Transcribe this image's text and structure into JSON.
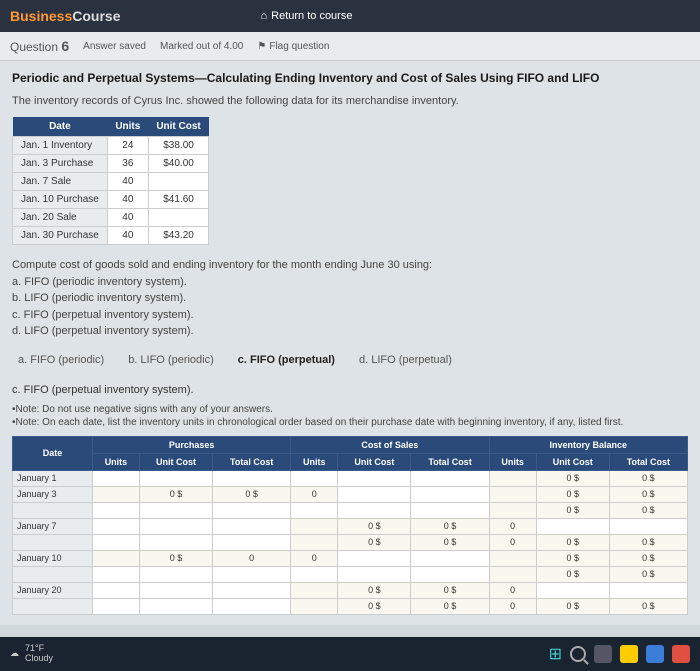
{
  "header": {
    "logo1": "Business",
    "logo2": "Course",
    "return": "Return to course"
  },
  "qbar": {
    "label": "Question",
    "num": "6",
    "saved": "Answer saved",
    "marked": "Marked out of 4.00",
    "flag": "Flag question"
  },
  "title": "Periodic and Perpetual Systems—Calculating Ending Inventory and Cost of Sales Using FIFO and LIFO",
  "intro": "The inventory records of Cyrus Inc. showed the following data for its merchandise inventory.",
  "inv": {
    "h1": "Date",
    "h2": "Units",
    "h3": "Unit Cost",
    "r1c1": "Jan. 1 Inventory",
    "r1c2": "24",
    "r1c3": "$38.00",
    "r2c1": "Jan. 3 Purchase",
    "r2c2": "36",
    "r2c3": "$40.00",
    "r3c1": "Jan. 7 Sale",
    "r3c2": "40",
    "r3c3": "",
    "r4c1": "Jan. 10 Purchase",
    "r4c2": "40",
    "r4c3": "$41.60",
    "r5c1": "Jan. 20 Sale",
    "r5c2": "40",
    "r5c3": "",
    "r6c1": "Jan. 30 Purchase",
    "r6c2": "40",
    "r6c3": "$43.20"
  },
  "compute": {
    "lead": "Compute cost of goods sold and ending inventory for the month ending June 30 using:",
    "a": "a. FIFO (periodic inventory system).",
    "b": "b. LIFO (periodic inventory system).",
    "c": "c. FIFO (perpetual inventory system).",
    "d": "d. LIFO (perpetual inventory system)."
  },
  "tabs": {
    "a": "a. FIFO (periodic)",
    "b": "b. LIFO (periodic)",
    "c": "c. FIFO (perpetual)",
    "d": "d. LIFO (perpetual)"
  },
  "subtitle": "c. FIFO (perpetual inventory system).",
  "note1": "•Note: Do not use negative signs with any of your answers.",
  "note2": "•Note: On each date, list the inventory units in chronological order based on their purchase date with beginning inventory, if any, listed first.",
  "mt": {
    "gP": "Purchases",
    "gC": "Cost of Sales",
    "gI": "Inventory Balance",
    "date": "Date",
    "units": "Units",
    "unitcost": "Unit Cost",
    "totalcost": "Total Cost",
    "d1": "January 1",
    "d3": "January 3",
    "d7": "January 7",
    "d10": "January 10",
    "d20": "January 20",
    "zero": "0",
    "zs": "0 $",
    "zd": "0 $"
  },
  "weather": {
    "temp": "71°F",
    "cond": "Cloudy"
  }
}
